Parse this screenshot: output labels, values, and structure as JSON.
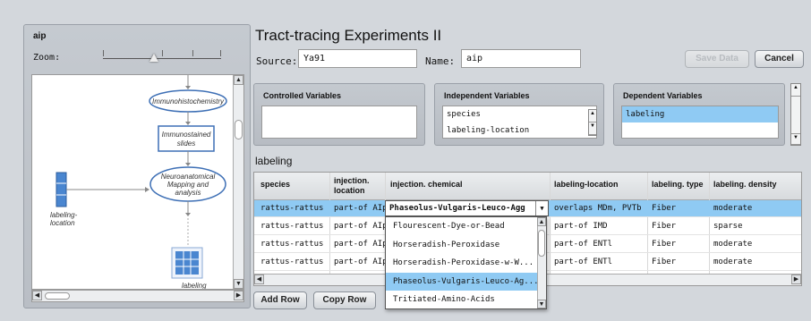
{
  "left_panel": {
    "title": "aip",
    "zoom_label": "Zoom:",
    "nodes": {
      "immunohistochemistry": "Immunohistochemistry",
      "immunostained_line1": "Immunostained",
      "immunostained_line2": "slides",
      "neuro_line1": "Neuroanatomical",
      "neuro_line2": "Mapping and",
      "neuro_line3": "analysis",
      "labeling_location_line1": "labeling-",
      "labeling_location_line2": "location",
      "labeling": "labeling"
    }
  },
  "header": {
    "title": "Tract-tracing Experiments II",
    "source_label": "Source:",
    "source_value": "Ya91",
    "name_label": "Name:",
    "name_value": "aip",
    "save_label": "Save Data",
    "cancel_label": "Cancel"
  },
  "variables": {
    "controlled_title": "Controlled Variables",
    "independent_title": "Independent Variables",
    "independent_items": [
      "species",
      "labeling-location"
    ],
    "dependent_title": "Dependent Variables",
    "dependent_items": [
      "labeling"
    ]
  },
  "table": {
    "section_label": "labeling",
    "headers": [
      "species",
      "injection.\nlocation",
      "injection. chemical",
      "labeling-location",
      "labeling. type",
      "labeling. density"
    ],
    "rows": [
      [
        "rattus-rattus",
        "part-of AIp",
        "Phaseolus-Vulgaris-Leuco-Agg",
        "overlaps MDm, PVTb",
        "Fiber",
        "moderate"
      ],
      [
        "rattus-rattus",
        "part-of AIp",
        "",
        "part-of IMD",
        "Fiber",
        "sparse"
      ],
      [
        "rattus-rattus",
        "part-of AIp",
        "",
        "part-of ENTl",
        "Fiber",
        "moderate"
      ],
      [
        "rattus-rattus",
        "part-of AIp",
        "",
        "part-of ENTl",
        "Fiber",
        "moderate"
      ]
    ],
    "editor_value": "Phaseolus-Vulgaris-Leuco-Agg",
    "dropdown_options": [
      "Flourescent-Dye-or-Bead",
      "Horseradish-Peroxidase",
      "Horseradish-Peroxidase-w-W...",
      "Phaseolus-Vulgaris-Leuco-Ag...",
      "Tritiated-Amino-Acids"
    ],
    "selected_option_index": 3
  },
  "footer": {
    "add_row_label": "Add Row",
    "copy_row_label": "Copy Row"
  },
  "colors": {
    "selection": "#8fcaf3",
    "node_stroke": "#3d6fb5"
  }
}
